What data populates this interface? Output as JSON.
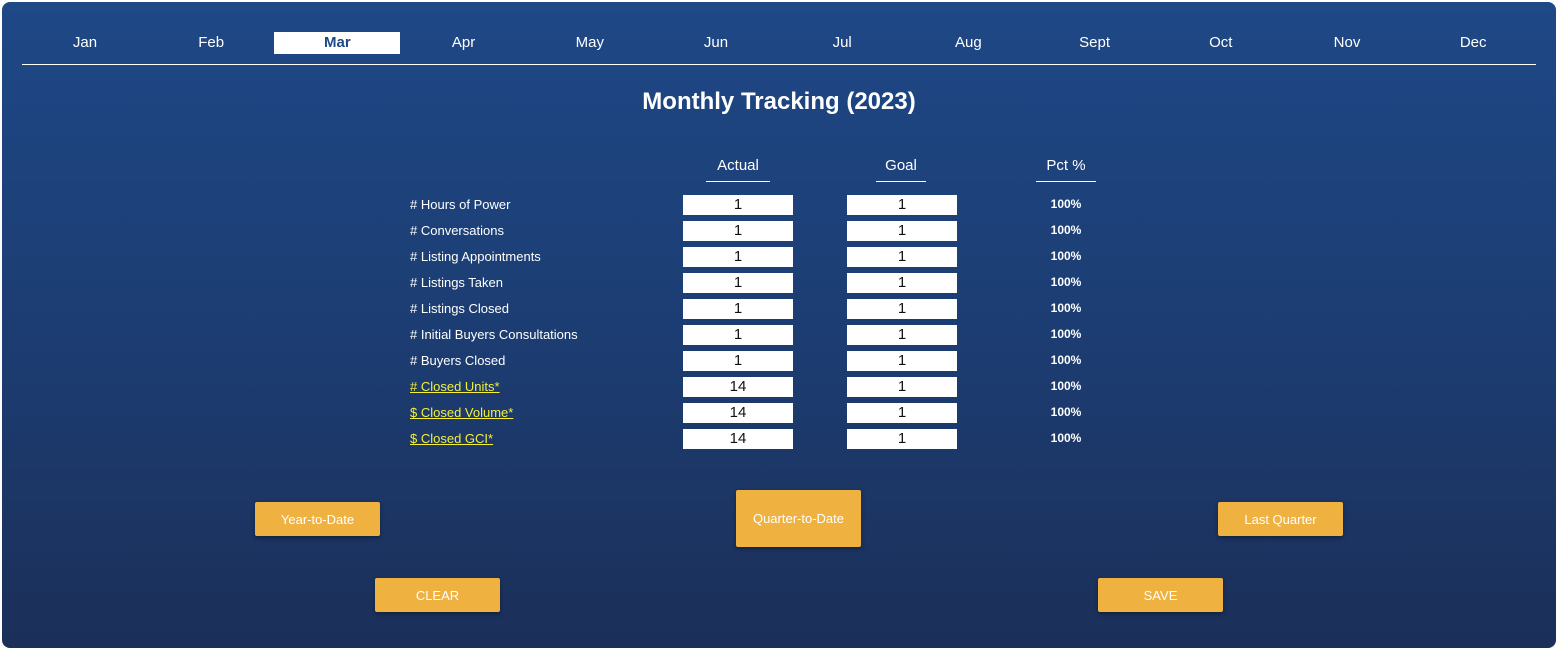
{
  "months": {
    "items": [
      "Jan",
      "Feb",
      "Mar",
      "Apr",
      "May",
      "Jun",
      "Jul",
      "Aug",
      "Sept",
      "Oct",
      "Nov",
      "Dec"
    ],
    "active": "Mar"
  },
  "title": "Monthly Tracking (2023)",
  "columns": {
    "actual": "Actual",
    "goal": "Goal",
    "pct": "Pct %"
  },
  "rows": [
    {
      "label": "# Hours of Power",
      "actual": "1",
      "goal": "1",
      "pct": "100%",
      "link": false
    },
    {
      "label": "# Conversations",
      "actual": "1",
      "goal": "1",
      "pct": "100%",
      "link": false
    },
    {
      "label": "# Listing Appointments",
      "actual": "1",
      "goal": "1",
      "pct": "100%",
      "link": false
    },
    {
      "label": "# Listings Taken",
      "actual": "1",
      "goal": "1",
      "pct": "100%",
      "link": false
    },
    {
      "label": "# Listings Closed",
      "actual": "1",
      "goal": "1",
      "pct": "100%",
      "link": false
    },
    {
      "label": "# Initial Buyers Consultations",
      "actual": "1",
      "goal": "1",
      "pct": "100%",
      "link": false
    },
    {
      "label": "# Buyers Closed",
      "actual": "1",
      "goal": "1",
      "pct": "100%",
      "link": false
    },
    {
      "label": "# Closed Units*",
      "actual": "14",
      "goal": "1",
      "pct": "100%",
      "link": true
    },
    {
      "label": "$ Closed Volume*",
      "actual": "14",
      "goal": "1",
      "pct": "100%",
      "link": true
    },
    {
      "label": "$ Closed GCI*",
      "actual": "14",
      "goal": "1",
      "pct": "100%",
      "link": true
    }
  ],
  "buttons": {
    "ytd": "Year-to-Date",
    "qtd": "Quarter-to-Date",
    "last_quarter": "Last Quarter",
    "clear": "CLEAR",
    "save": "SAVE"
  },
  "colors": {
    "accent": "#efb13f",
    "link": "#f5ef3a",
    "panel_top": "#1e4886",
    "panel_bottom": "#1b2f58"
  }
}
